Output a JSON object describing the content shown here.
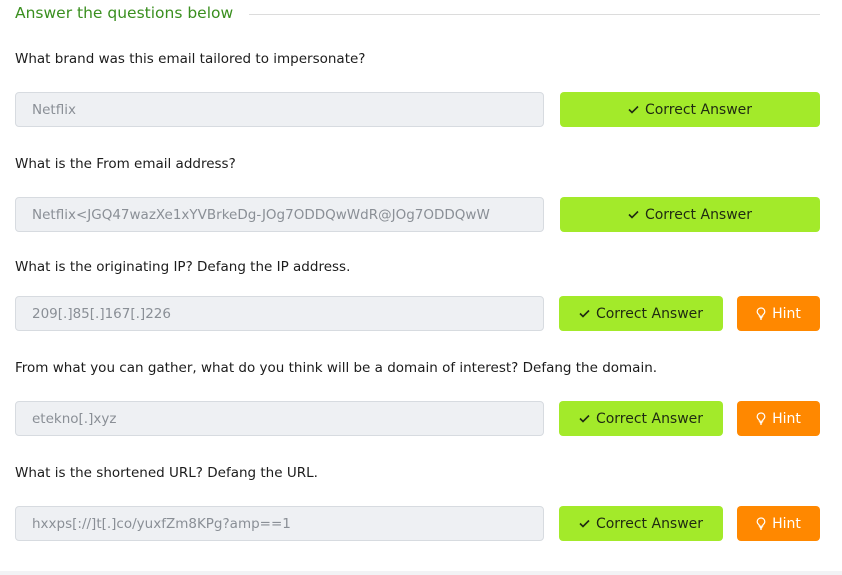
{
  "section": {
    "title": "Answer the questions below"
  },
  "questions": [
    {
      "label": "What brand was this email tailored to impersonate?",
      "answer": "Netflix",
      "correct_label": "Correct Answer",
      "hint_label": null
    },
    {
      "label": "What is the From email address?",
      "answer": "Netflix<JGQ47wazXe1xYVBrkeDg-JOg7ODDQwWdR@JOg7ODDQwW",
      "correct_label": "Correct Answer",
      "hint_label": null
    },
    {
      "label": "What is the originating IP? Defang the IP address.",
      "answer": "209[.]85[.]167[.]226",
      "correct_label": "Correct Answer",
      "hint_label": "Hint"
    },
    {
      "label": "From what you can gather, what do you think will be a domain of interest? Defang the domain.",
      "answer": "etekno[.]xyz",
      "correct_label": "Correct Answer",
      "hint_label": "Hint"
    },
    {
      "label": "What is the shortened URL? Defang the URL.",
      "answer": "hxxps[://]t[.]co/yuxfZm8KPg?amp==1",
      "correct_label": "Correct Answer",
      "hint_label": "Hint"
    }
  ],
  "icons": {
    "correct": "check-icon",
    "hint": "lightbulb-icon"
  },
  "colors": {
    "section_title": "#3a8f1f",
    "correct_button": "#a3ea2a",
    "hint_button": "#ff8800",
    "answer_field_bg": "#eef0f3"
  }
}
